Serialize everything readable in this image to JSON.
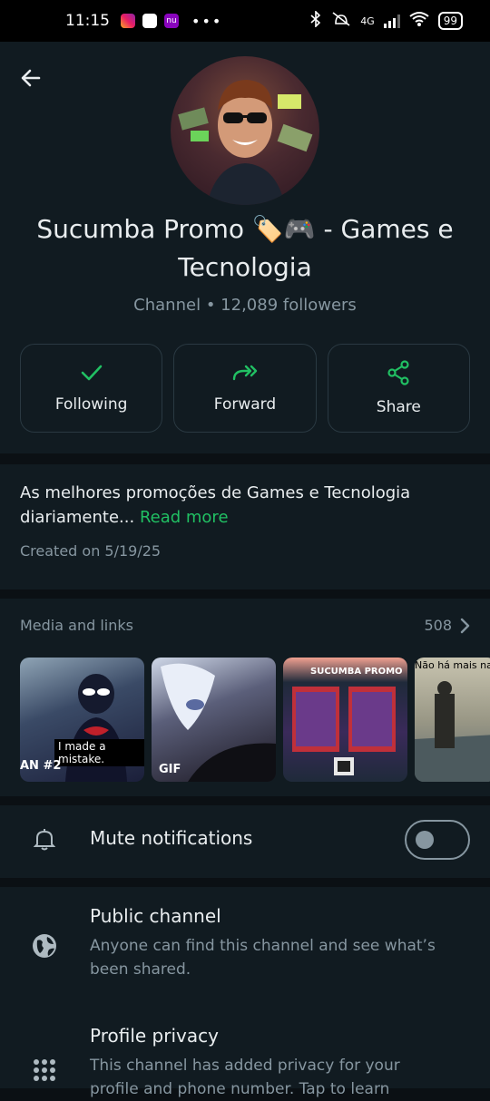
{
  "status_bar": {
    "time": "11:15",
    "app_icons": [
      "instagram-icon",
      "amazon-icon",
      "nubank-icon"
    ],
    "nubank_label": "nu",
    "more": "•••",
    "network": "4G",
    "battery": "99"
  },
  "channel": {
    "name": "Sucumba Promo 🏷️🎮 - Games e Tecnologia",
    "type": "Channel",
    "followers": "12,089 followers",
    "meta_separator": "•"
  },
  "actions": {
    "following": "Following",
    "forward": "Forward",
    "share": "Share"
  },
  "about": {
    "description": "As melhores promoções de Games e Tecnologia diariamente...",
    "read_more": "Read more",
    "created": "Created on 5/19/25"
  },
  "media": {
    "title": "Media and links",
    "count": "508",
    "thumbs": [
      {
        "caption": "I made a mistake.",
        "badge": "AN #2"
      },
      {
        "badge": "GIF"
      },
      {
        "label": "SUCUMBA PROMO"
      },
      {
        "caption": "Não há mais nada"
      }
    ]
  },
  "settings": {
    "mute_title": "Mute notifications",
    "mute_enabled": false,
    "public_title": "Public channel",
    "public_desc": "Anyone can find this channel and see what’s been shared.",
    "privacy_title": "Profile privacy",
    "privacy_desc": "This channel has added privacy for your profile and phone number. Tap to learn"
  },
  "colors": {
    "accent": "#21c063",
    "background": "#111b21",
    "muted_text": "#8696a0"
  }
}
